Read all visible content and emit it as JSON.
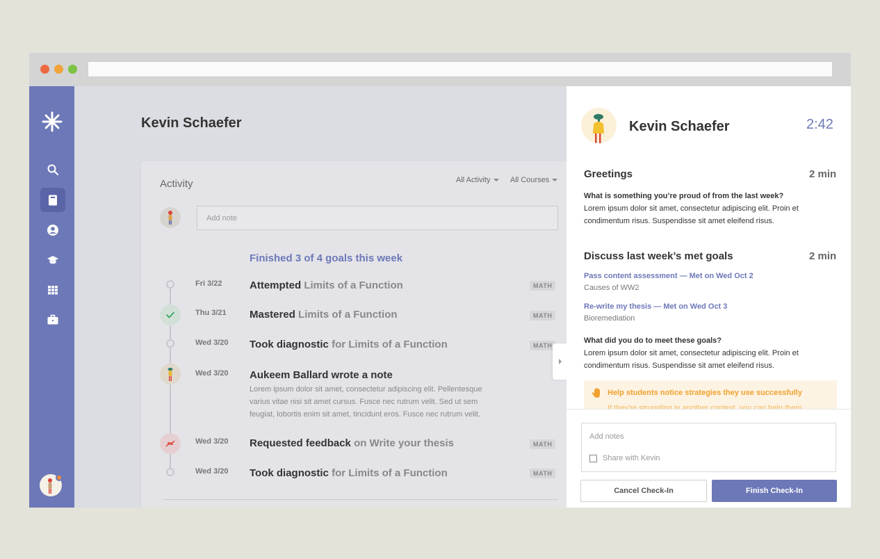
{
  "student": {
    "name": "Kevin Schaefer"
  },
  "activity": {
    "title": "Activity",
    "filters": [
      "All Activity",
      "All Courses"
    ],
    "note_placeholder": "Add note",
    "summary": "Finished 3 of 4 goals this week",
    "items": [
      {
        "date": "Fri 3/22",
        "action": "Attempted",
        "object": "Limits of a Function",
        "tag": "MATH",
        "marker": "empty"
      },
      {
        "date": "Thu 3/21",
        "action": "Mastered",
        "object": "Limits of a Function",
        "tag": "MATH",
        "marker": "check"
      },
      {
        "date": "Wed 3/20",
        "action": "Took diagnostic",
        "object": "for Limits of a Function",
        "tag": "MATH",
        "marker": "empty"
      },
      {
        "date": "Wed 3/20",
        "action": "Aukeem Ballard wrote a note",
        "object": "",
        "tag": "",
        "marker": "avatar",
        "body": "Lorem ipsum dolor sit amet, consectetur adipiscing elit. Pellentesque varius vitae nisi sit amet cursus. Fusce nec rutrum velit. Sed ut sem feugiat, lobortis enim sit amet, tincidunt eros. Fusce nec rutrum velit."
      },
      {
        "date": "Wed 3/20",
        "action": "Requested feedback",
        "object": "on Write your thesis",
        "tag": "MATH",
        "marker": "feedback"
      },
      {
        "date": "Wed 3/20",
        "action": "Took diagnostic",
        "object": "for Limits of a Function",
        "tag": "MATH",
        "marker": "empty"
      }
    ]
  },
  "checkin": {
    "name": "Kevin Schaefer",
    "timer": "2:42",
    "sections": [
      {
        "title": "Greetings",
        "time": "2 min",
        "question": "What is something you’re proud of from the last week?",
        "answer": "Lorem ipsum dolor sit amet, consectetur adipiscing elit. Proin et condimentum risus. Suspendisse sit amet eleifend risus."
      },
      {
        "title": "Discuss last week’s met goals",
        "time": "2 min",
        "goals": [
          {
            "link": "Pass content assessment  — Met on Wed Oct 2",
            "sub": "Causes of WW2"
          },
          {
            "link": "Re-write my thesis — Met on Wed Oct 3",
            "sub": "Bioremediation"
          }
        ],
        "question": "What did you do to meet these goals?",
        "answer": "Lorem ipsum dolor sit amet, consectetur adipiscing elit. Proin et condimentum risus. Suspendisse sit amet eleifend risus."
      }
    ],
    "tip": {
      "title": "Help students notice strategies they use successfully",
      "sub": "If they’re struggling in another context, you can help them"
    },
    "notes_placeholder": "Add notes",
    "share_label": "Share with Kevin",
    "cancel_label": "Cancel Check-In",
    "finish_label": "Finish Check-In"
  },
  "colors": {
    "accent": "#6d78b8",
    "sidebar": "#6d78b8",
    "tip": "#f0a12f"
  }
}
